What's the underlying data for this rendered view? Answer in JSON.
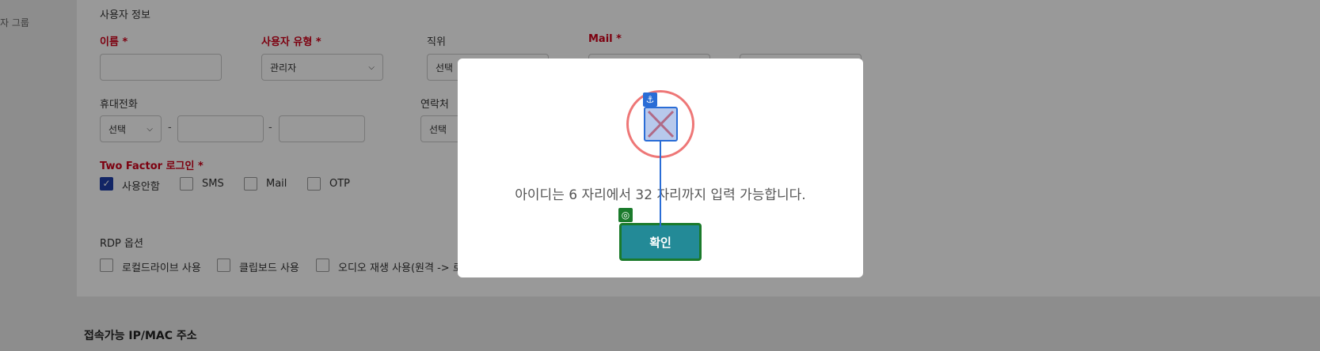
{
  "sidebar": {
    "group_label": "자 그룹"
  },
  "form": {
    "section_title": "사용자 정보",
    "name_label": "이름 *",
    "user_type_label": "사용자 유형 *",
    "user_type_value": "관리자",
    "position_label": "직위",
    "position_value": "선택",
    "mail_label": "Mail *",
    "mobile_label": "휴대전화",
    "mobile_select_value": "선택",
    "contact_label": "연락처",
    "contact_select_value": "선택",
    "dash": "-",
    "two_factor_label": "Two Factor 로그인 *",
    "two_factor_options": [
      {
        "label": "사용안함",
        "checked": true
      },
      {
        "label": "SMS",
        "checked": false
      },
      {
        "label": "Mail",
        "checked": false
      },
      {
        "label": "OTP",
        "checked": false
      }
    ],
    "rdp_label": "RDP 옵션",
    "rdp_options": [
      {
        "label": "로컬드라이브 사용",
        "checked": false
      },
      {
        "label": "클립보드 사용",
        "checked": false
      },
      {
        "label": "오디오 재생 사용(원격 -> 로컬)",
        "checked": false
      }
    ]
  },
  "ip_mac_section_title": "접속가능 IP/MAC 주소",
  "modal": {
    "message": "아이디는 6 자리에서 32 자리까지 입력 가능합니다.",
    "ok_label": "확인"
  },
  "annotation": {
    "anchor_icon": "anchor-icon",
    "target_icon": "target-icon",
    "colors": {
      "circle": "#ee7777",
      "anchor": "#2a6dd6",
      "target": "#1a7a2b"
    }
  }
}
